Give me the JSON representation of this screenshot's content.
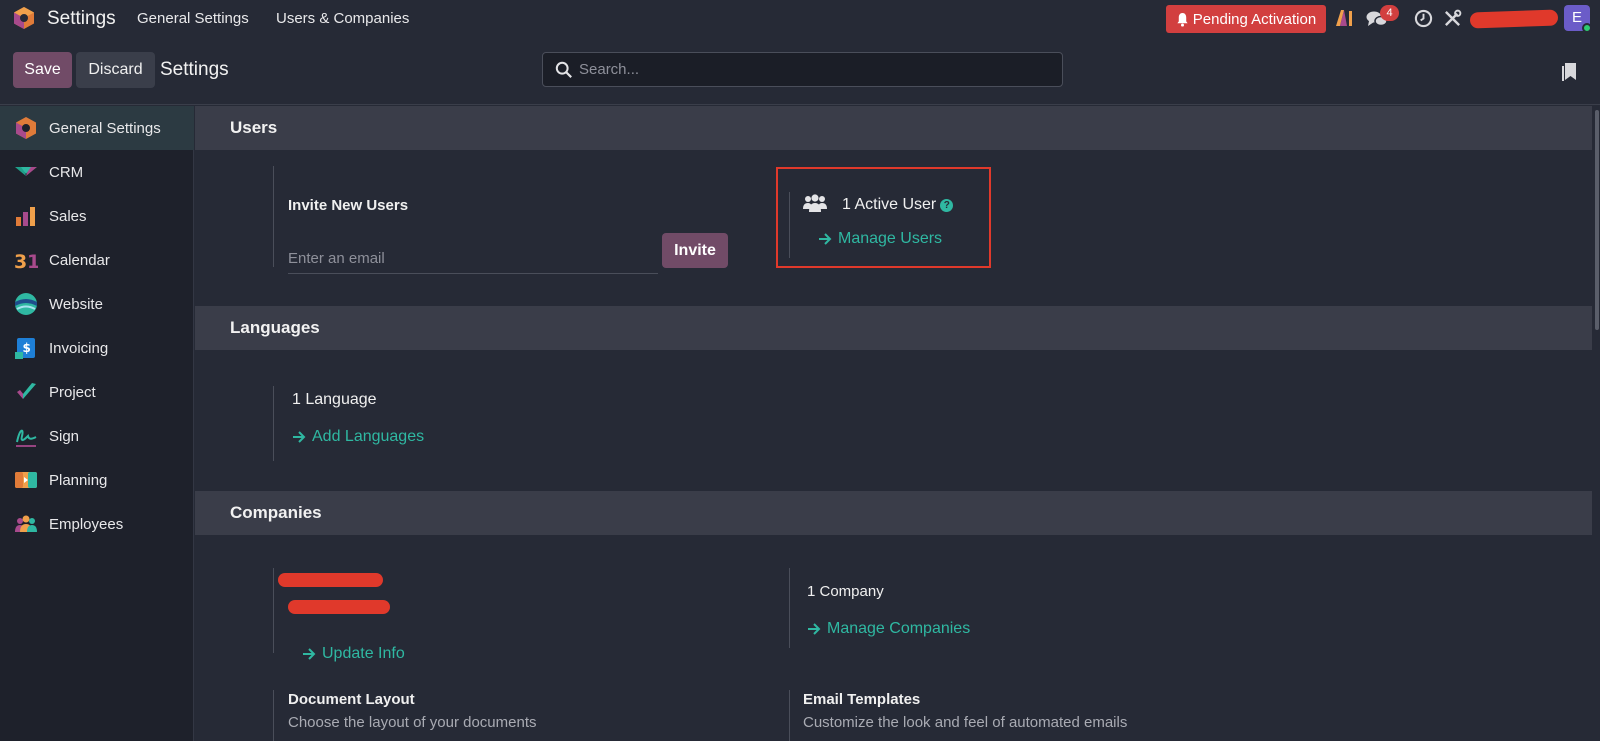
{
  "topbar": {
    "app_name": "Settings",
    "menu": [
      "General Settings",
      "Users & Companies"
    ],
    "pending_label": "Pending Activation",
    "message_count": "4",
    "avatar_initial": "E"
  },
  "control": {
    "save_label": "Save",
    "discard_label": "Discard",
    "breadcrumb": "Settings",
    "search_placeholder": "Search..."
  },
  "sidebar": {
    "items": [
      {
        "label": "General Settings",
        "icon": "settings-icon",
        "active": true
      },
      {
        "label": "CRM",
        "icon": "crm-icon"
      },
      {
        "label": "Sales",
        "icon": "sales-icon"
      },
      {
        "label": "Calendar",
        "icon": "calendar-icon"
      },
      {
        "label": "Website",
        "icon": "website-icon"
      },
      {
        "label": "Invoicing",
        "icon": "invoicing-icon"
      },
      {
        "label": "Project",
        "icon": "project-icon"
      },
      {
        "label": "Sign",
        "icon": "sign-icon"
      },
      {
        "label": "Planning",
        "icon": "planning-icon"
      },
      {
        "label": "Employees",
        "icon": "employees-icon"
      }
    ]
  },
  "users": {
    "title": "Users",
    "invite_title": "Invite New Users",
    "email_placeholder": "Enter an email",
    "invite_label": "Invite",
    "active_users": "1 Active User",
    "manage_users": "Manage Users"
  },
  "languages": {
    "title": "Languages",
    "count": "1 Language",
    "add_languages": "Add Languages"
  },
  "companies": {
    "title": "Companies",
    "update_info": "Update Info",
    "count": "1 Company",
    "manage_companies": "Manage Companies",
    "doc_layout_title": "Document Layout",
    "doc_layout_desc": "Choose the layout of your documents",
    "email_templates_title": "Email Templates",
    "email_templates_desc": "Customize the look and feel of automated emails"
  },
  "colors": {
    "accent": "#714b67",
    "link": "#2fb8a2",
    "danger": "#d23f3f",
    "highlight": "#e0392b"
  }
}
